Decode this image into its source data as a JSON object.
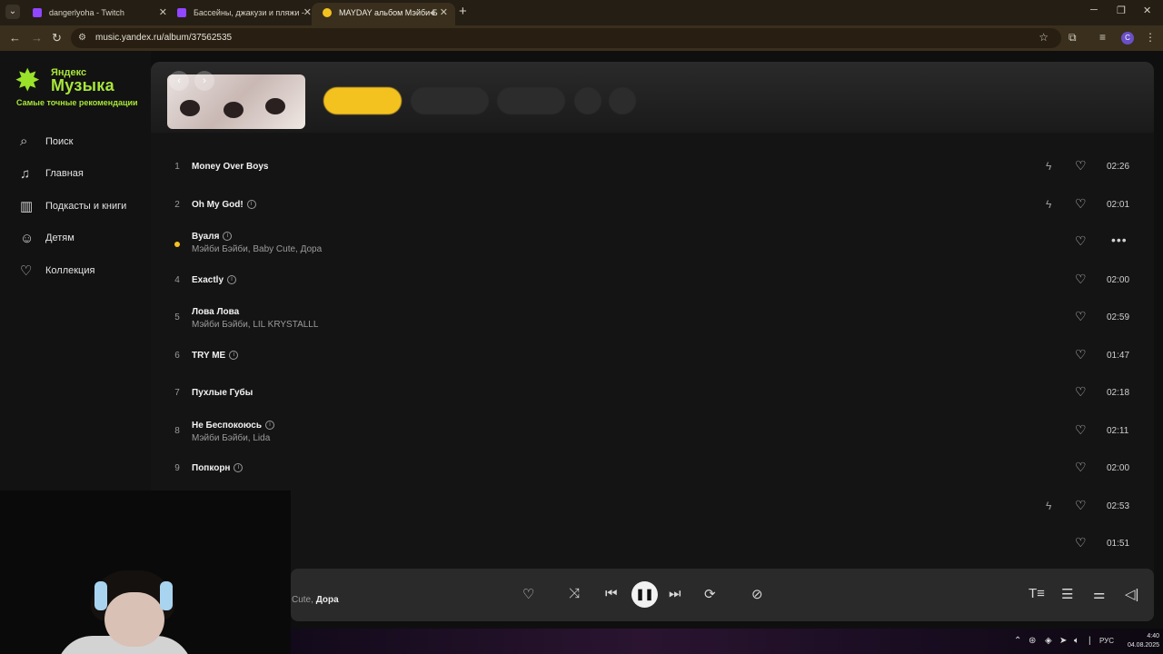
{
  "browser": {
    "tabs": [
      {
        "title": "dangerlyoha - Twitch",
        "favicon_color": "#9146ff"
      },
      {
        "title": "Бассейны, джакузи и пляжи - ",
        "favicon_color": "#9146ff"
      },
      {
        "title": "MAYDAY альбом Мэйби Б",
        "favicon_color": "#f4c21f"
      }
    ],
    "url": "music.yandex.ru/album/37562535",
    "profile_initial": "C"
  },
  "logo": {
    "top": "Яндекс",
    "main": "Музыка",
    "tagline": "Самые точные рекомендации"
  },
  "nav": [
    {
      "label": "Поиск",
      "icon": "search-icon"
    },
    {
      "label": "Главная",
      "icon": "music-note-icon"
    },
    {
      "label": "Подкасты и книги",
      "icon": "book-icon"
    },
    {
      "label": "Детям",
      "icon": "kids-icon"
    },
    {
      "label": "Коллекция",
      "icon": "heart-icon"
    }
  ],
  "tracks": [
    {
      "num": "1",
      "title": "Money Over Boys",
      "artist": "",
      "info": false,
      "bolt": true,
      "duration": "02:26"
    },
    {
      "num": "2",
      "title": "Oh My God!",
      "artist": "",
      "info": true,
      "bolt": true,
      "duration": "02:01"
    },
    {
      "num": "",
      "title": "Вуаля",
      "artist": "Мэйби Бэйби, Baby Cute, Дора",
      "info": true,
      "bolt": false,
      "duration": "",
      "playing": true
    },
    {
      "num": "4",
      "title": "Exactly",
      "artist": "",
      "info": true,
      "bolt": false,
      "duration": "02:00"
    },
    {
      "num": "5",
      "title": "Лова Лова",
      "artist": "Мэйби Бэйби, LIL KRYSTALLL",
      "info": false,
      "bolt": false,
      "duration": "02:59"
    },
    {
      "num": "6",
      "title": "TRY ME",
      "artist": "",
      "info": true,
      "bolt": false,
      "duration": "01:47"
    },
    {
      "num": "7",
      "title": "Пухлые Губы",
      "artist": "",
      "info": false,
      "bolt": false,
      "duration": "02:18"
    },
    {
      "num": "8",
      "title": "Не Беспокоюсь",
      "artist": "Мэйби Бэйби, Lida",
      "info": true,
      "bolt": false,
      "duration": "02:11"
    },
    {
      "num": "9",
      "title": "Попкорн",
      "artist": "",
      "info": true,
      "bolt": false,
      "duration": "02:00"
    },
    {
      "num": "",
      "title": "",
      "artist": "",
      "info": false,
      "bolt": true,
      "duration": "02:53"
    },
    {
      "num": "",
      "title": "",
      "artist": "",
      "info": false,
      "bolt": false,
      "duration": "01:51"
    }
  ],
  "player": {
    "artist_prefix": "Cute, ",
    "artist_current": "Дора"
  },
  "taskbar": {
    "lang": "РУС",
    "time": "4:40",
    "date": "04.08.2025"
  }
}
